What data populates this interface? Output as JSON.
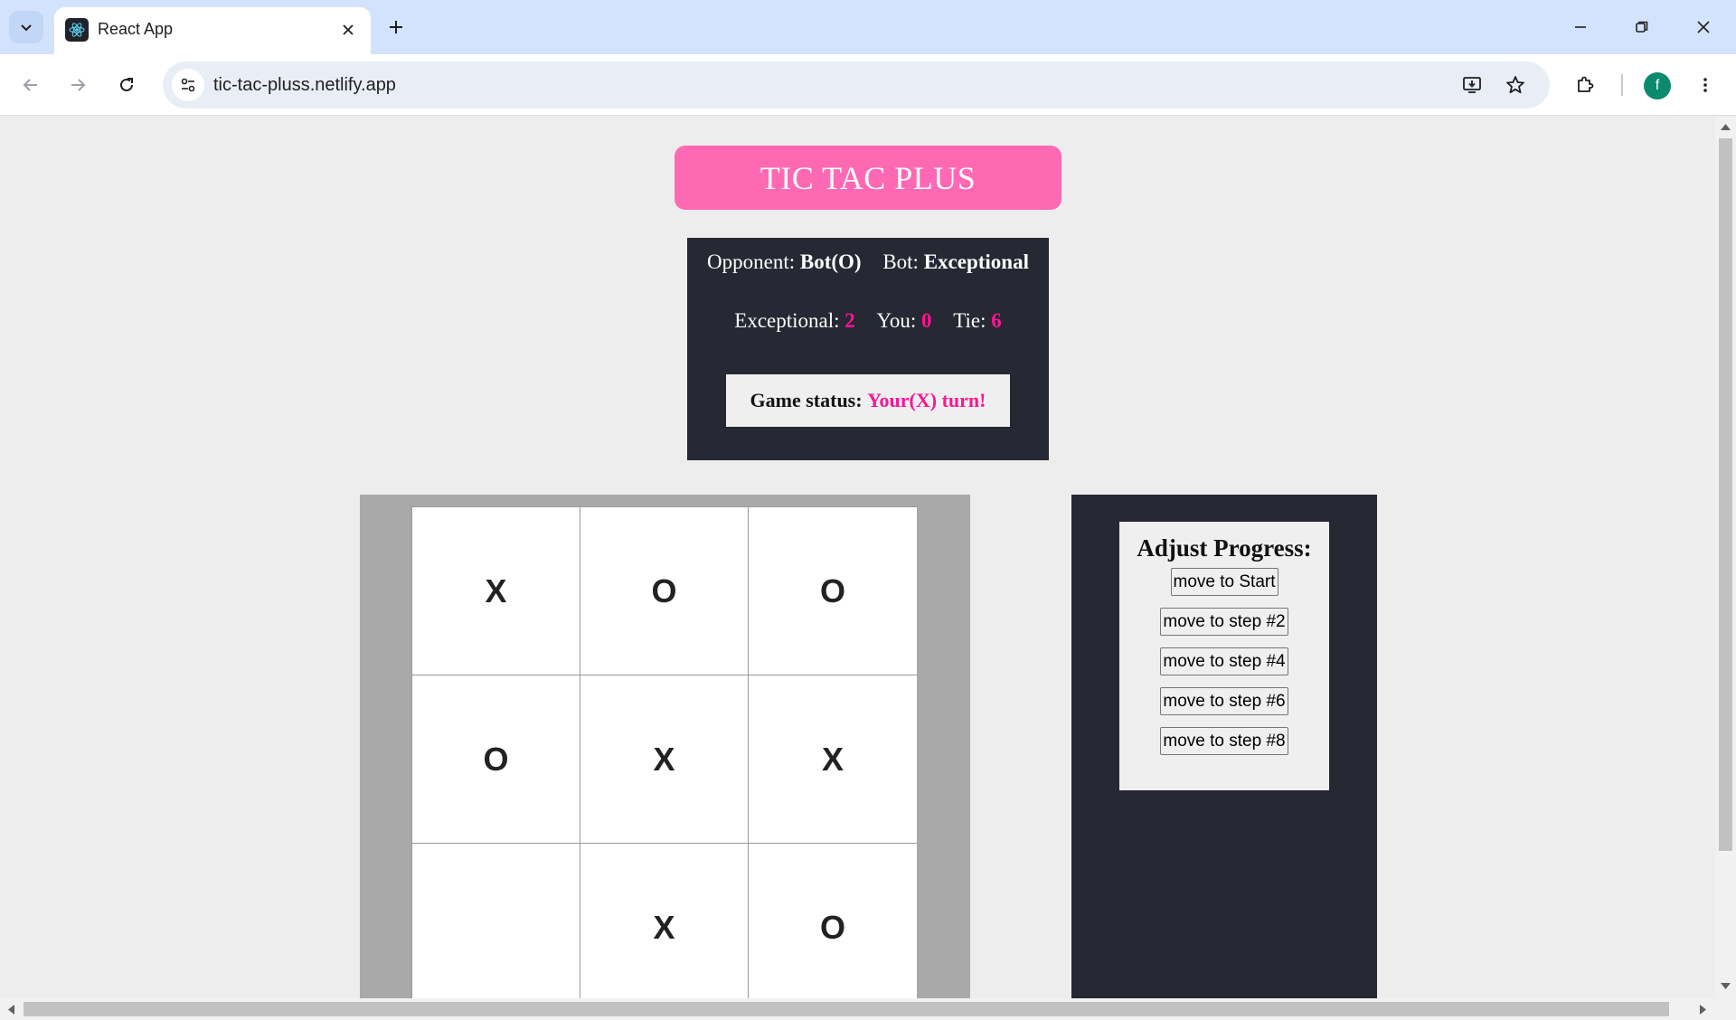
{
  "browser": {
    "tab_title": "React App",
    "url": "tic-tac-pluss.netlify.app",
    "avatar_letter": "f"
  },
  "game": {
    "title": "TIC TAC PLUS",
    "opponent_label": "Opponent:",
    "opponent_value": "Bot(O)",
    "bot_label": "Bot:",
    "bot_value": "Exceptional",
    "score": {
      "bot_label": "Exceptional:",
      "bot_score": "2",
      "you_label": "You:",
      "you_score": "0",
      "tie_label": "Tie:",
      "tie_score": "6"
    },
    "status_label": "Game status:",
    "status_value": "Your(X) turn!",
    "board": [
      "X",
      "O",
      "O",
      "O",
      "X",
      "X",
      "",
      "X",
      "O"
    ]
  },
  "progress": {
    "title": "Adjust Progress:",
    "moves": [
      "move to Start",
      "move to step #2",
      "move to step #4",
      "move to step #6",
      "move to step #8"
    ]
  },
  "colors": {
    "accent_pink": "#ff69b4",
    "score_pink": "#ff1493",
    "panel_dark": "#262833",
    "board_frame": "#a9a9a9"
  }
}
